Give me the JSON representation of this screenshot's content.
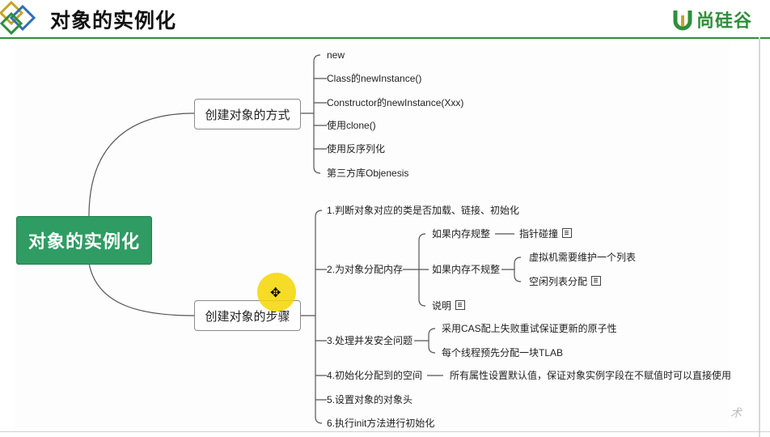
{
  "header": {
    "title": "对象的实例化",
    "brand": "尚硅谷"
  },
  "mindmap": {
    "root": "对象的实例化",
    "ways": {
      "label": "创建对象的方式",
      "items": [
        "new",
        "Class的newInstance()",
        "Constructor的newInstance(Xxx)",
        "使用clone()",
        "使用反序列化",
        "第三方库Objenesis"
      ]
    },
    "steps": {
      "label": "创建对象的步骤",
      "s1": "1.判断对象对应的类是否加载、链接、初始化",
      "s2": "2.为对象分配内存",
      "s2_regular": "如果内存规整",
      "s2_regular_child": "指针碰撞",
      "s2_irregular": "如果内存不规整",
      "s2_irregular_c1": "虚拟机需要维护一个列表",
      "s2_irregular_c2": "空闲列表分配",
      "s2_note": "说明",
      "s3": "3.处理并发安全问题",
      "s3_c1": "采用CAS配上失败重试保证更新的原子性",
      "s3_c2": "每个线程预先分配一块TLAB",
      "s4": "4.初始化分配到的空间",
      "s4_c1": "所有属性设置默认值，保证对象实例字段在不赋值时可以直接使用",
      "s5": "5.设置对象的对象头",
      "s6": "6.执行init方法进行初始化"
    }
  },
  "colors": {
    "root": "#2f9c63",
    "brand": "#2f8f3a",
    "cursor": "#f5d600"
  },
  "watermark": "术"
}
